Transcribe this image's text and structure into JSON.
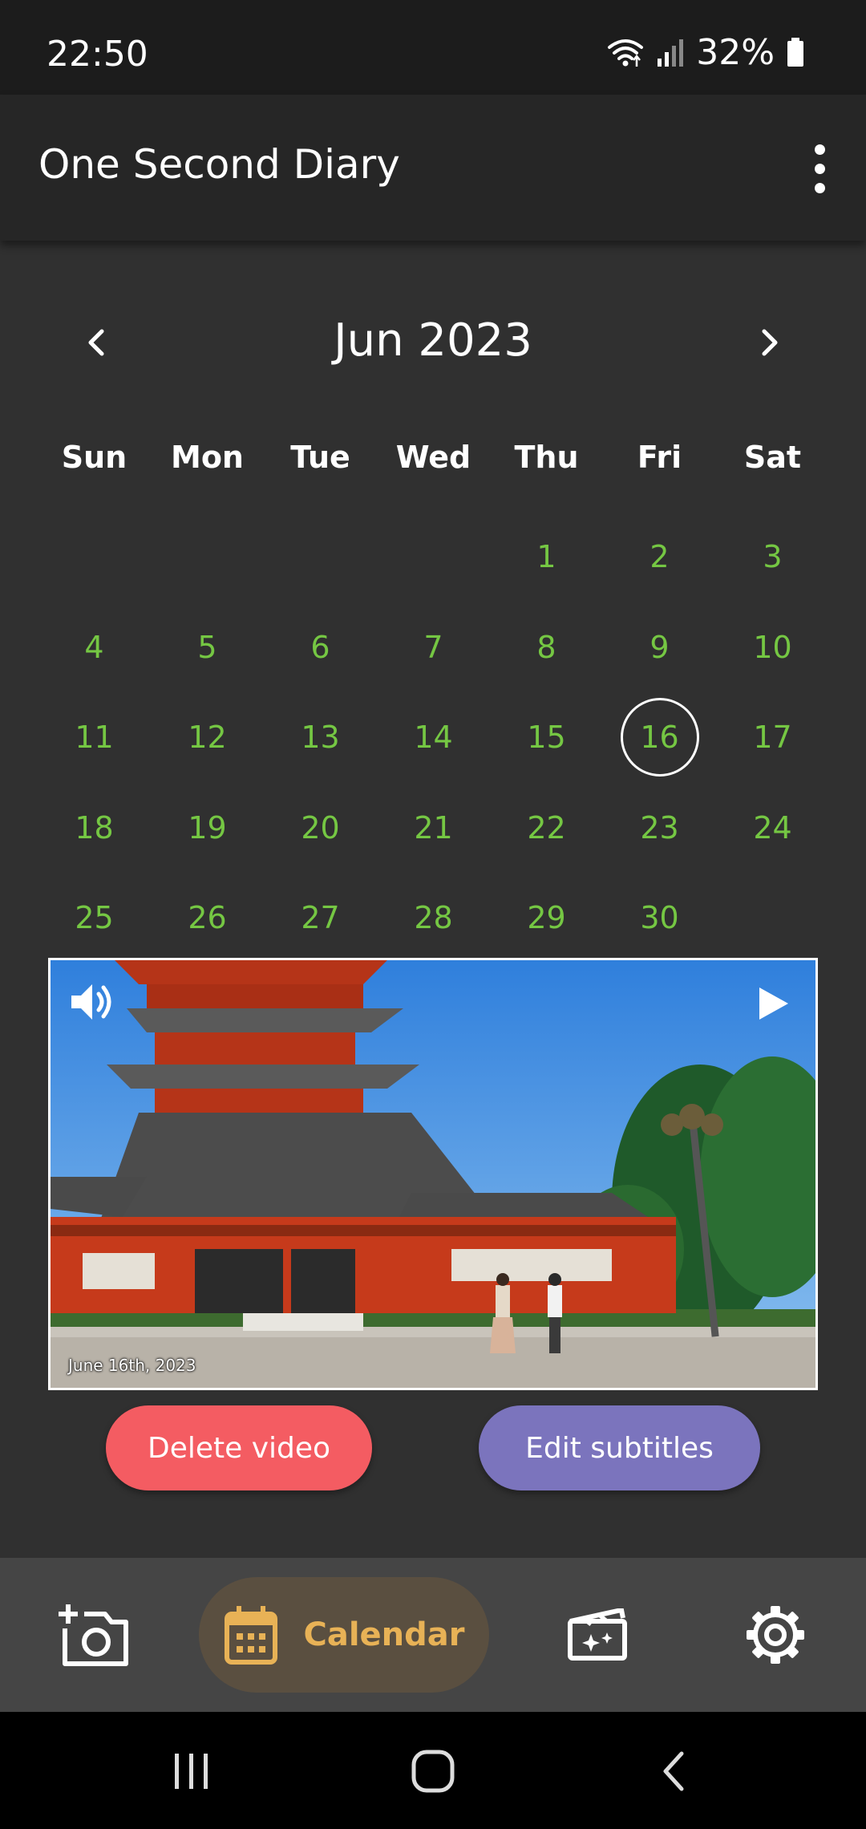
{
  "status_bar": {
    "time": "22:50",
    "battery": "32%",
    "icons": [
      "wifi-icon",
      "signal-icon",
      "battery-icon"
    ]
  },
  "app_bar": {
    "title": "One Second Diary",
    "menu_icon": "more-vert-icon"
  },
  "calendar": {
    "month_label": "Jun 2023",
    "prev_icon": "chevron-left-icon",
    "next_icon": "chevron-right-icon",
    "weekdays": [
      "Sun",
      "Mon",
      "Tue",
      "Wed",
      "Thu",
      "Fri",
      "Sat"
    ],
    "leading_blank_days": 4,
    "days": [
      "1",
      "2",
      "3",
      "4",
      "5",
      "6",
      "7",
      "8",
      "9",
      "10",
      "11",
      "12",
      "13",
      "14",
      "15",
      "16",
      "17",
      "18",
      "19",
      "20",
      "21",
      "22",
      "23",
      "24",
      "25",
      "26",
      "27",
      "28",
      "29",
      "30"
    ],
    "selected_day": "16",
    "day_color": "#75c743"
  },
  "video": {
    "caption": "June 16th, 2023",
    "volume_icon": "volume-up-icon",
    "play_icon": "play-icon"
  },
  "actions": {
    "delete_label": "Delete video",
    "delete_color": "#f45c62",
    "subtitles_label": "Edit subtitles",
    "subtitles_color": "#7b74bd"
  },
  "bottom_nav": {
    "items": [
      {
        "icon": "add-camera-icon",
        "label": ""
      },
      {
        "icon": "calendar-icon",
        "label": "Calendar",
        "active": true
      },
      {
        "icon": "movie-edit-icon",
        "label": ""
      },
      {
        "icon": "settings-gear-icon",
        "label": ""
      }
    ],
    "active_color": "#e8b256"
  },
  "system_nav": {
    "icons": [
      "recents-icon",
      "home-icon",
      "back-icon"
    ]
  }
}
